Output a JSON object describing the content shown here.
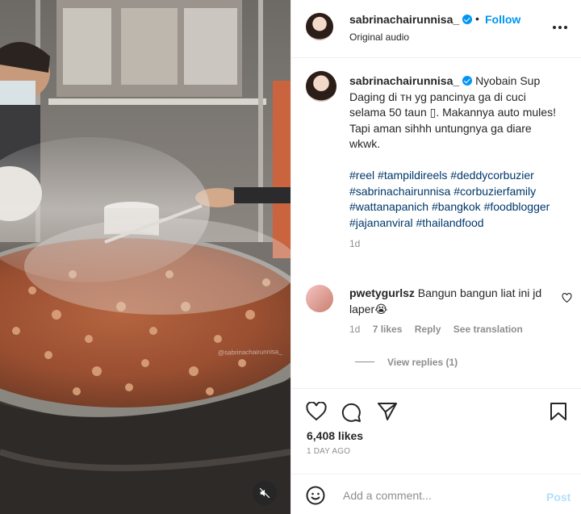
{
  "header": {
    "username": "sabrinachairunnisa_",
    "separator": "•",
    "follow_label": "Follow",
    "audio": "Original audio"
  },
  "caption": {
    "username": "sabrinachairunnisa_",
    "text": "Nyobain Sup Daging di тн yg pancinya ga di cuci selama 50 taun ▯. Makannya auto mules! Tapi aman sihhh untungnya ga diare wkwk.",
    "hashtags": [
      "#reel",
      "#tampildireels",
      "#deddycorbuzier",
      "#sabrinachairunnisa",
      "#corbuzierfamily",
      "#wattanapanich",
      "#bangkok",
      "#foodblogger",
      "#jajananviral",
      "#thailandfood"
    ],
    "time": "1d"
  },
  "comment": {
    "username": "pwetygurlsz",
    "text": "Bangun bangun liat ini jd laper😭",
    "time": "1d",
    "likes": "7 likes",
    "reply": "Reply",
    "translate": "See translation",
    "view_replies": "View replies (1)"
  },
  "post_stats": {
    "likes": "6,408 likes",
    "ago": "1 DAY AGO"
  },
  "add_comment": {
    "placeholder": "Add a comment...",
    "post_label": "Post"
  },
  "media": {
    "watermark": "@sabrinachairunnisa_"
  },
  "colors": {
    "accent": "#0095f6",
    "link": "#00376b",
    "muted": "#8e8e8e",
    "post_disabled": "#b2dffc"
  }
}
